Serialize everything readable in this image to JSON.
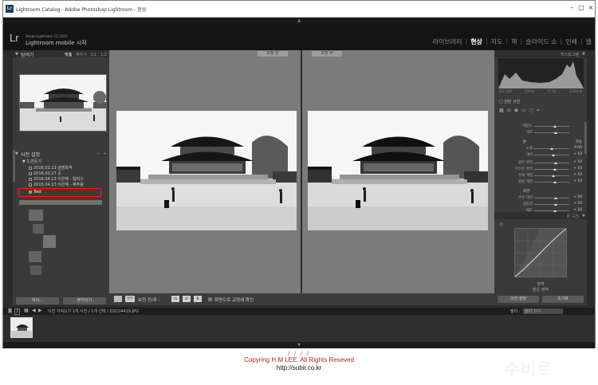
{
  "window": {
    "title": "Lightroom Catalog - Adobe Photoshop Lightroom - 현상",
    "controls": [
      "minimize-icon",
      "maximize-icon",
      "close-icon"
    ]
  },
  "identity": {
    "logo": "Lr",
    "product_line": "Adobe Lightroom CC 2015",
    "plate_text": "Lightroom mobile 시작"
  },
  "modules": {
    "items": [
      "라이브러리",
      "현상",
      "지도",
      "책",
      "슬라이드 쇼",
      "인쇄",
      "웹"
    ],
    "active": "현상"
  },
  "left_panel": {
    "navigator": {
      "title": "탐색기",
      "zoom_options": [
        "맞춤",
        "채우기",
        "1:1",
        "1:2"
      ],
      "active_zoom": "맞춤"
    },
    "presets": {
      "title": "사전 설정",
      "add": "+",
      "remove": "−",
      "folder": "1.만든기",
      "items": [
        "2016.03.13 설명복적",
        "2016.03.27 곳",
        "2016.04.13 이은혜 - 뭡피스",
        "2016.04.13 이은혜 - 제주람",
        "Test"
      ],
      "selected": "Test"
    },
    "buttons": {
      "copy": "복사...",
      "paste": "붙여넣기"
    }
  },
  "center": {
    "before_label": "보정 전",
    "after_label": "보정 후"
  },
  "toolbar": {
    "view_mode": "Y|Y",
    "before_after_label": "보정 전/후 :",
    "soft_proof_label": "화면으로 교정쇄 확인"
  },
  "right_panel": {
    "histogram_title": "히스토그램",
    "histogram_info": [
      "ISO 100",
      "35mm",
      "f / 10",
      "1/250 초"
    ],
    "original_photo": "원본 사진",
    "sliders": [
      {
        "name": "색온도",
        "pos": 0.58,
        "val": ""
      },
      {
        "name": "색조",
        "pos": 0.62,
        "val": ""
      },
      {
        "name": "톤",
        "pos": -1,
        "val": "자동"
      },
      {
        "name": "노출",
        "pos": 0.5,
        "val": "0.00"
      },
      {
        "name": "대비",
        "pos": 0.55,
        "val": "+ 10"
      },
      {
        "name": "밝은 영역",
        "pos": 0.62,
        "val": "+ 10"
      },
      {
        "name": "어두운 영역",
        "pos": 0.58,
        "val": "+ 10"
      },
      {
        "name": "흰색 계열",
        "pos": 0.55,
        "val": "+ 10"
      },
      {
        "name": "검정 계열",
        "pos": 0.58,
        "val": "+ 10"
      },
      {
        "name": "외관",
        "pos": -1,
        "val": ""
      },
      {
        "name": "부분 대비",
        "pos": 0.62,
        "val": "+ 20"
      },
      {
        "name": "생동감",
        "pos": 0.62,
        "val": "+ 20"
      },
      {
        "name": "채도",
        "pos": 0.6,
        "val": "+ 10"
      }
    ],
    "tone_curve_title": "톤 곡선",
    "region_label": "영역",
    "highlights_label": "밝은 영역",
    "buttons": {
      "previous": "이전 설정",
      "reset": "초기화"
    }
  },
  "filmstrip_bar": {
    "pages": [
      "1",
      "2"
    ],
    "info": "이전 가져오기  1개 사진 / 1개 선택 / DSC04419.JPG",
    "filter_label": "필터 :",
    "filter_value": "필터 끄기"
  },
  "caption": {
    "slashes": "/ / / /",
    "copyright": "Copyring H.M LEE. All Rights Reseved",
    "url": "http://subir.co.kr"
  },
  "colors": {
    "highlight_outline": "#ff1a1a",
    "caption_red": "#c02020",
    "panel_bg": "#3a3a3a",
    "viewer_bg": "#7b7b7b"
  }
}
